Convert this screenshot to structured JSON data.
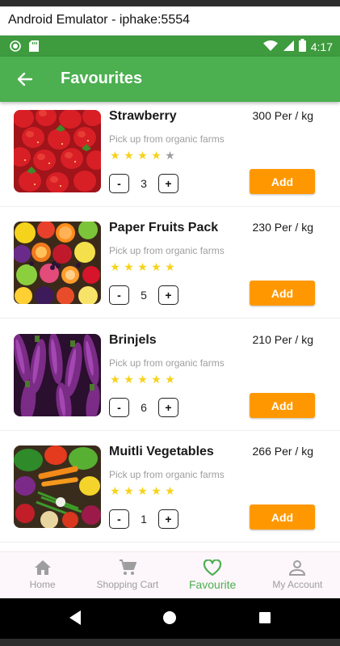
{
  "window": {
    "title": "Android Emulator - iphake:5554"
  },
  "status_bar": {
    "time": "4:17"
  },
  "app_bar": {
    "title": "Favourites"
  },
  "colors": {
    "primary": "#4caf50",
    "accent": "#ff9800",
    "star": "#f5d31b",
    "star_empty": "#9e9e9e"
  },
  "products": [
    {
      "name": "Strawberry",
      "price": "300 Per / kg",
      "subtitle": "Pick up from organic farms",
      "rating": 4,
      "max_rating": 5,
      "quantity": "3",
      "decrement": "-",
      "increment": "+",
      "add_label": "Add",
      "image_icon": "strawberry-image"
    },
    {
      "name": "Paper Fruits Pack",
      "price": "230 Per / kg",
      "subtitle": "Pick up from organic farms",
      "rating": 5,
      "max_rating": 5,
      "quantity": "5",
      "decrement": "-",
      "increment": "+",
      "add_label": "Add",
      "image_icon": "fruits-image"
    },
    {
      "name": "Brinjels",
      "price": "210 Per / kg",
      "subtitle": "Pick up from organic farms",
      "rating": 5,
      "max_rating": 5,
      "quantity": "6",
      "decrement": "-",
      "increment": "+",
      "add_label": "Add",
      "image_icon": "brinjal-image"
    },
    {
      "name": "Muitli Vegetables",
      "price": "266 Per / kg",
      "subtitle": "Pick up from organic farms",
      "rating": 5,
      "max_rating": 5,
      "quantity": "1",
      "decrement": "-",
      "increment": "+",
      "add_label": "Add",
      "image_icon": "vegetables-image"
    }
  ],
  "bottom_nav": {
    "items": [
      {
        "label": "Home",
        "icon": "home-icon",
        "active": false
      },
      {
        "label": "Shopping Cart",
        "icon": "cart-icon",
        "active": false
      },
      {
        "label": "Favourite",
        "icon": "heart-icon",
        "active": true
      },
      {
        "label": "My Account",
        "icon": "account-icon",
        "active": false
      }
    ]
  }
}
